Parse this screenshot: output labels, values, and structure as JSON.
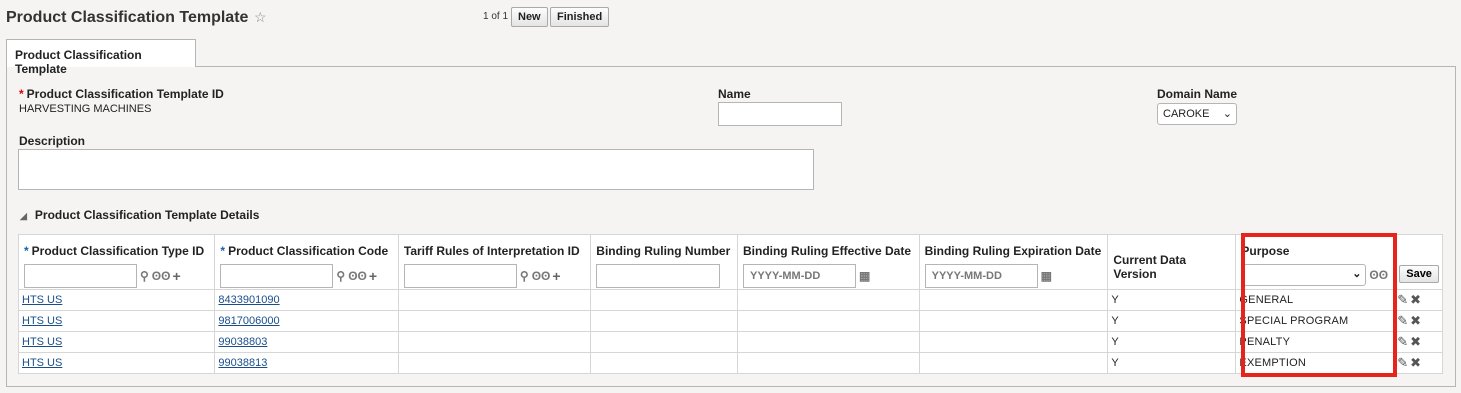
{
  "page": {
    "title": "Product Classification Template",
    "pager": "1 of 1",
    "new_label": "New",
    "finished_label": "Finished",
    "tab_label": "Product Classification Template"
  },
  "form": {
    "template_id_label": "Product Classification Template ID",
    "template_id_value": "HARVESTING MACHINES",
    "name_label": "Name",
    "name_value": "",
    "domain_label": "Domain Name",
    "domain_value": "CAROKE",
    "description_label": "Description",
    "description_value": ""
  },
  "details": {
    "section_title": "Product Classification Template Details",
    "columns": [
      "Product Classification Type ID",
      "Product Classification Code",
      "Tariff Rules of Interpretation ID",
      "Binding Ruling Number",
      "Binding Ruling Effective Date",
      "Binding Ruling Expiration Date",
      "Current Data Version",
      "Purpose"
    ],
    "date_placeholder": "YYYY-MM-DD",
    "save_label": "Save",
    "rows": [
      {
        "type_id": "HTS US",
        "code": "8433901090",
        "tariff": "",
        "ruling_no": "",
        "eff_date": "",
        "exp_date": "",
        "version": "Y",
        "purpose": "GENERAL"
      },
      {
        "type_id": "HTS US",
        "code": "9817006000",
        "tariff": "",
        "ruling_no": "",
        "eff_date": "",
        "exp_date": "",
        "version": "Y",
        "purpose": "SPECIAL PROGRAM"
      },
      {
        "type_id": "HTS US",
        "code": "99038803",
        "tariff": "",
        "ruling_no": "",
        "eff_date": "",
        "exp_date": "",
        "version": "Y",
        "purpose": "PENALTY"
      },
      {
        "type_id": "HTS US",
        "code": "99038813",
        "tariff": "",
        "ruling_no": "",
        "eff_date": "",
        "exp_date": "",
        "version": "Y",
        "purpose": "EXEMPTION"
      }
    ]
  },
  "colors": {
    "highlight": "#e8231b",
    "link": "#1a4e8a",
    "required_red": "#dd0000",
    "required_blue": "#1a5fb4"
  }
}
